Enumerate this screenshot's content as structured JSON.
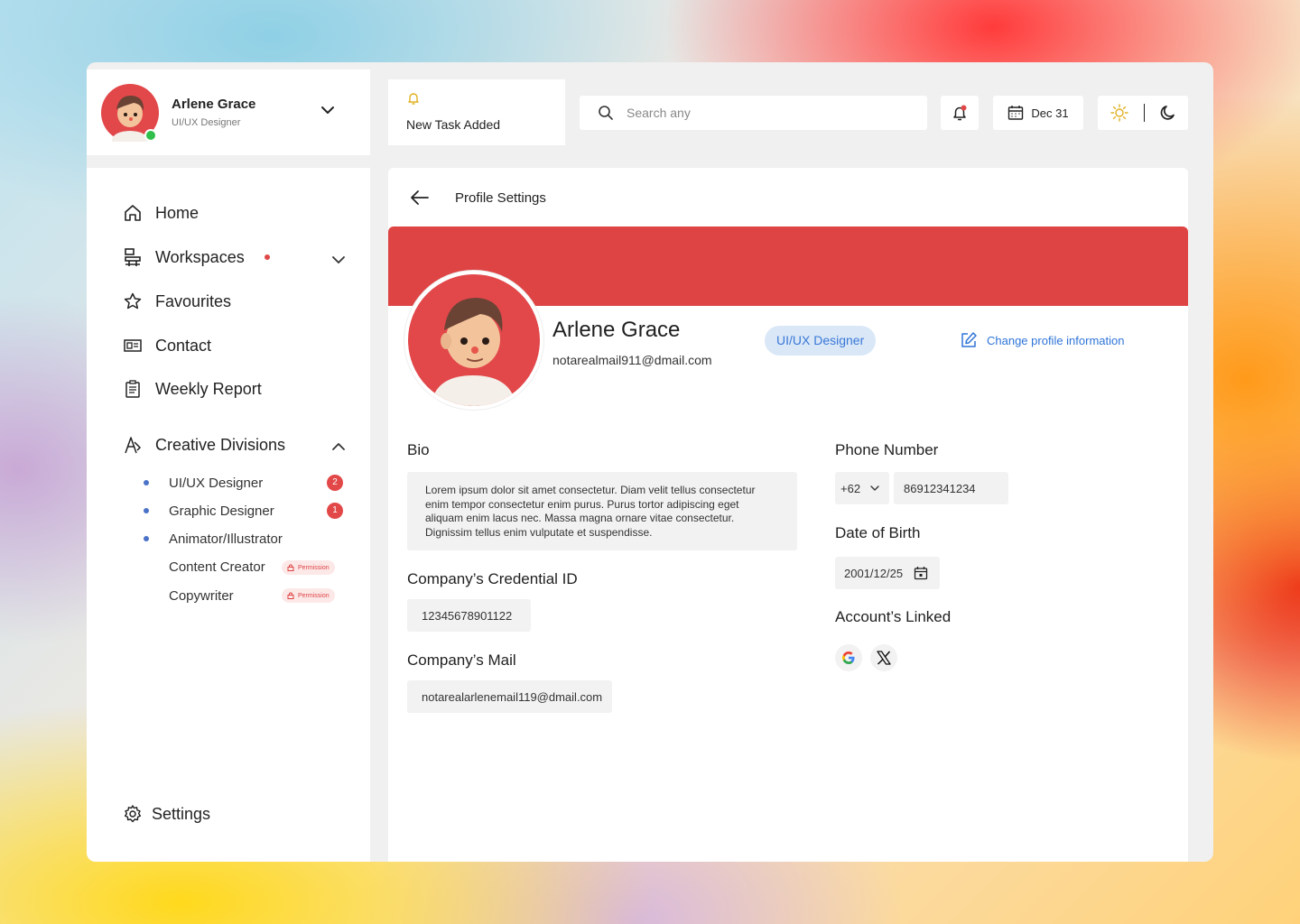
{
  "user": {
    "name": "Arlene Grace",
    "role": "UI/UX Designer"
  },
  "nav": {
    "home": "Home",
    "workspaces": "Workspaces",
    "favourites": "Favourites",
    "contact": "Contact",
    "weekly_report": "Weekly Report",
    "creative_divisions": "Creative Divisions",
    "settings": "Settings"
  },
  "divisions": [
    {
      "label": "UI/UX Designer",
      "badge": "2"
    },
    {
      "label": "Graphic Designer",
      "badge": "1"
    },
    {
      "label": "Animator/Illustrator"
    },
    {
      "label": "Content Creator",
      "tag": "Permission"
    },
    {
      "label": "Copywriter",
      "tag": "Permission"
    }
  ],
  "topbar": {
    "notification": "New Task Added",
    "search_placeholder": "Search any",
    "date": "Dec 31"
  },
  "page": {
    "title": "Profile Settings",
    "name": "Arlene Grace",
    "email": "notarealmail911@dmail.com",
    "role_pill": "UI/UX Designer",
    "change_link": "Change profile information",
    "bio_label": "Bio",
    "bio": "Lorem ipsum dolor sit amet consectetur. Diam velit tellus consectetur enim tempor consectetur enim purus. Purus tortor adipiscing eget aliquam enim lacus nec. Massa magna ornare vitae consectetur. Dignissim tellus enim vulputate et suspendisse.",
    "credential_label": "Company’s Credential ID",
    "credential": "12345678901122",
    "company_mail_label": "Company’s Mail",
    "company_mail": "notarealarlenemail119@dmail.com",
    "phone_label": "Phone Number",
    "phone_code": "+62",
    "phone": "86912341234",
    "dob_label": "Date of Birth",
    "dob": "2001/12/25",
    "accounts_label": "Account’s Linked"
  },
  "colors": {
    "accent_red": "#de4444",
    "link_blue": "#2e74d8",
    "online_green": "#2fbf4a"
  }
}
